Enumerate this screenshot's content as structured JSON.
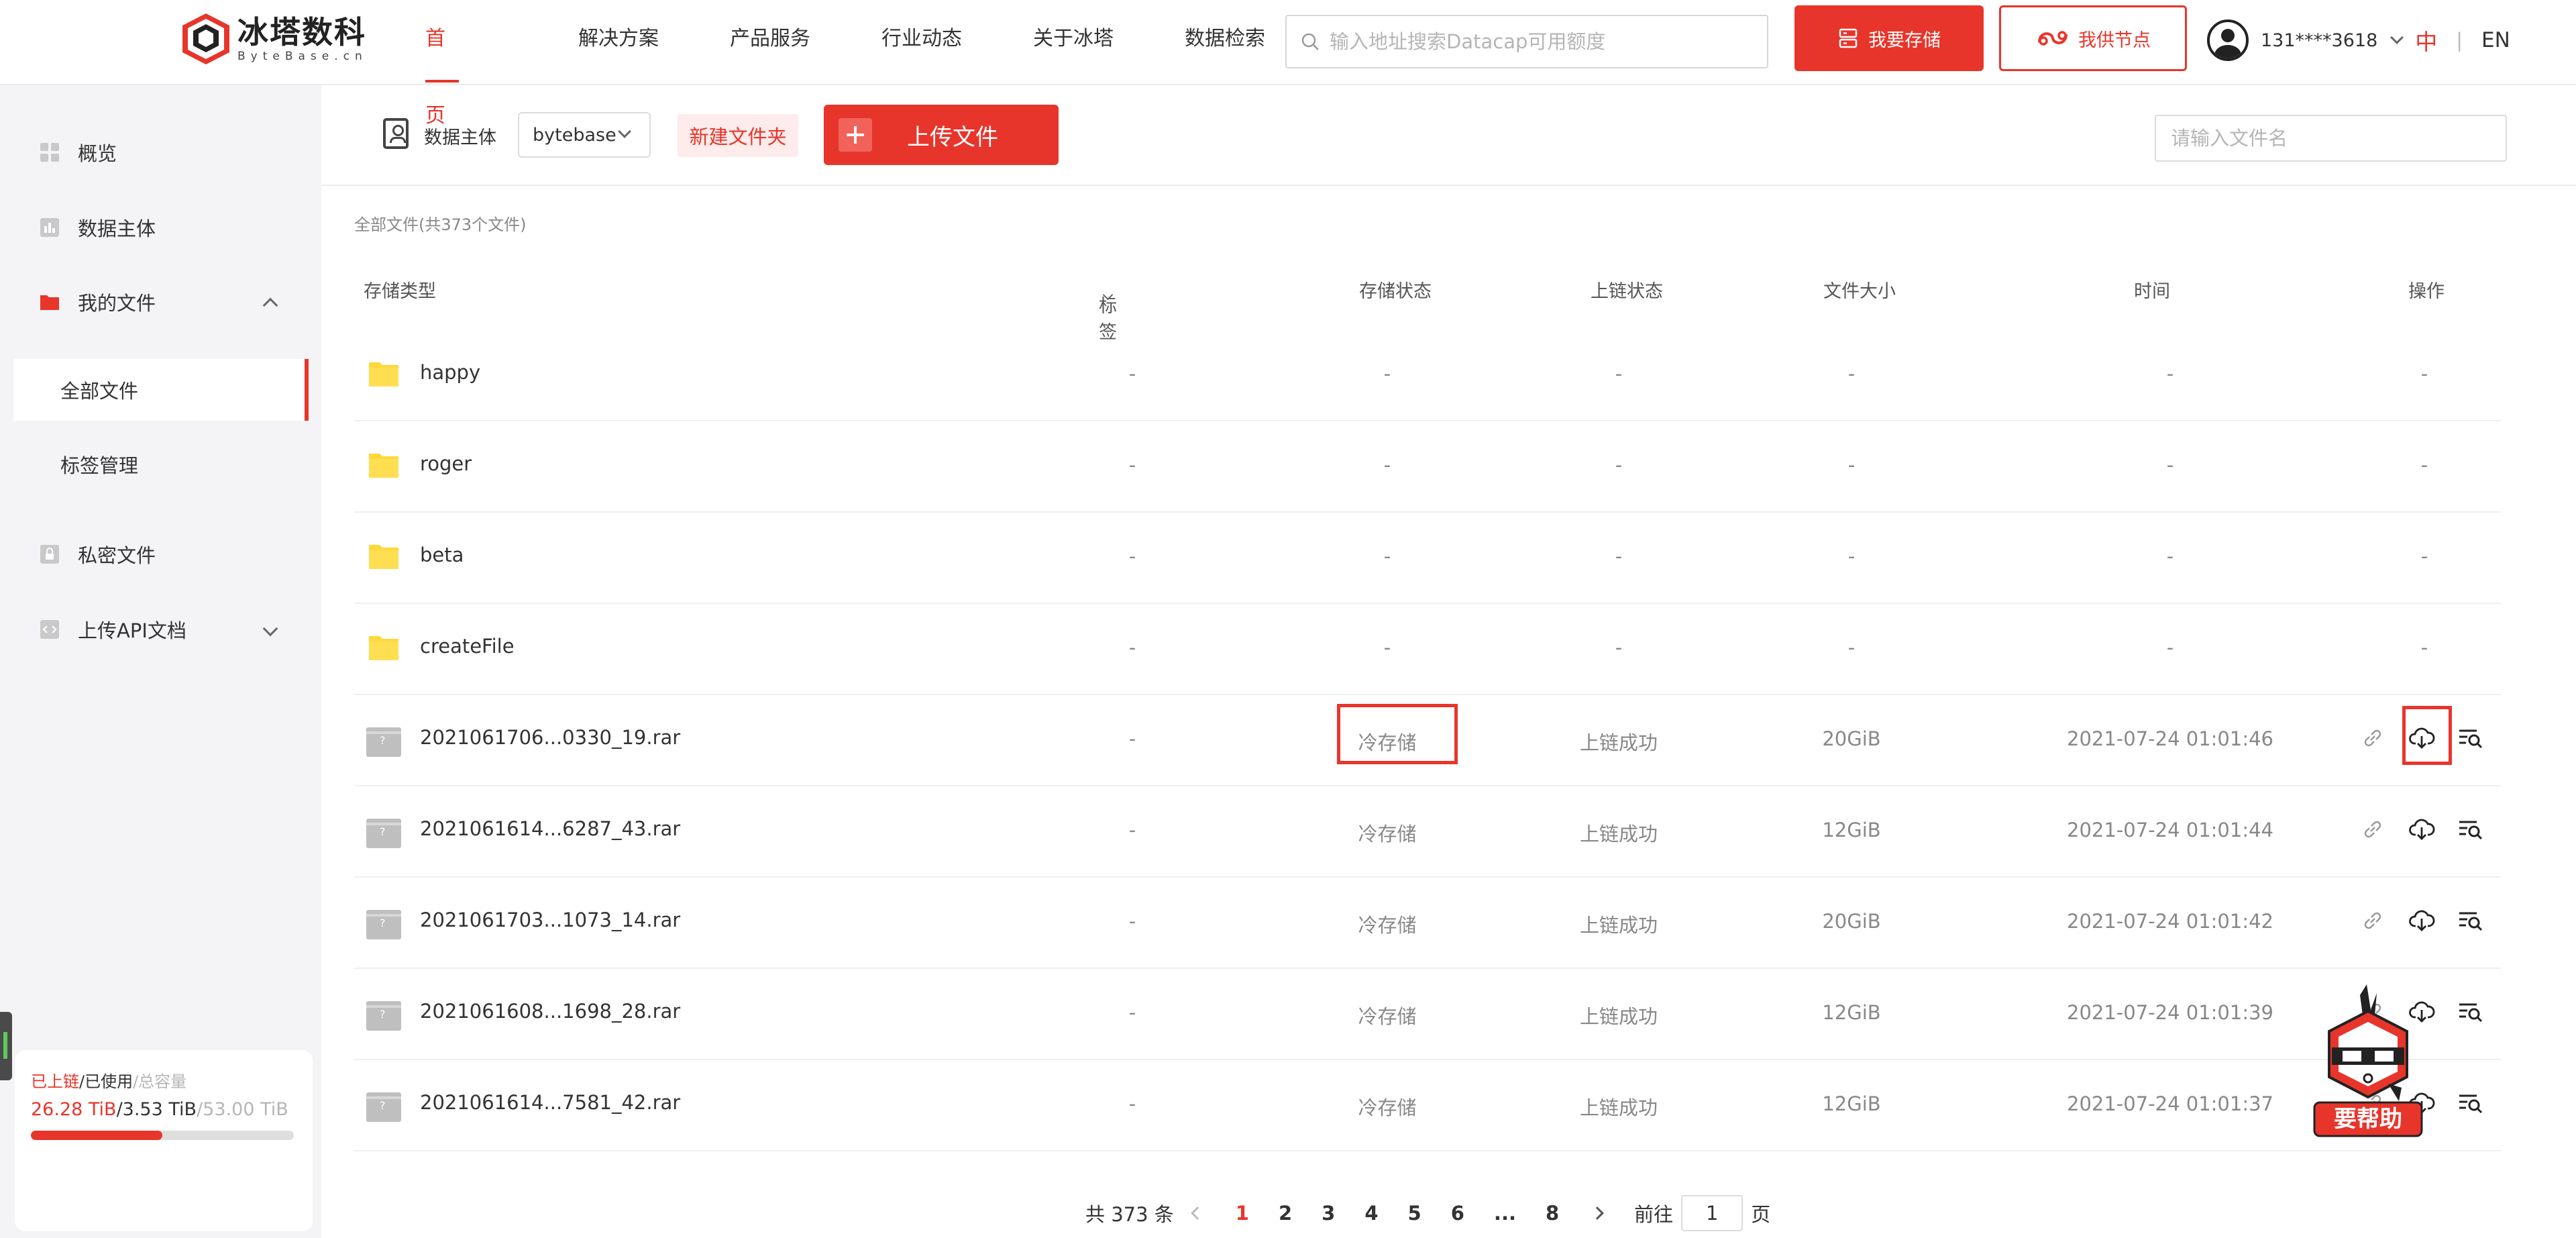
{
  "header": {
    "logo_cn": "冰塔数科",
    "logo_en": "ByteBase.cn",
    "nav": [
      "首页",
      "解决方案",
      "产品服务",
      "行业动态",
      "关于冰塔",
      "数据检索"
    ],
    "search_placeholder": "输入地址搜索Datacap可用额度",
    "btn_store": "我要存储",
    "btn_node": "我供节点",
    "user_phone": "131****3618",
    "lang_zh": "中",
    "lang_sep": "|",
    "lang_en": "EN"
  },
  "sidebar": {
    "overview": "概览",
    "entity": "数据主体",
    "myfiles": "我的文件",
    "allfiles": "全部文件",
    "tags": "标签管理",
    "private": "私密文件",
    "api": "上传API文档"
  },
  "storage": {
    "label_chain": "已上链",
    "label_used": "/已使用",
    "label_total": "/总容量",
    "val_chain": "26.28 TiB",
    "val_used": "/3.53 TiB",
    "val_total": "/53.00 TiB",
    "progress": 0.5
  },
  "toolbar": {
    "entity_label": "数据主体",
    "entity_value": "bytebase",
    "new_folder": "新建文件夹",
    "upload": "上传文件",
    "search_placeholder": "请输入文件名"
  },
  "crumb": "全部文件(共373个文件)",
  "table": {
    "headers": {
      "type": "存储类型",
      "tag": "标签",
      "state": "存储状态",
      "chain": "上链状态",
      "size": "文件大小",
      "time": "时间",
      "op": "操作"
    },
    "rows": [
      {
        "kind": "folder",
        "name": "happy",
        "tag": "-",
        "state": "-",
        "chain": "-",
        "size": "-",
        "time": "-",
        "op": "-"
      },
      {
        "kind": "folder",
        "name": "roger",
        "tag": "-",
        "state": "-",
        "chain": "-",
        "size": "-",
        "time": "-",
        "op": "-"
      },
      {
        "kind": "folder",
        "name": "beta",
        "tag": "-",
        "state": "-",
        "chain": "-",
        "size": "-",
        "time": "-",
        "op": "-"
      },
      {
        "kind": "folder",
        "name": "createFile",
        "tag": "-",
        "state": "-",
        "chain": "-",
        "size": "-",
        "time": "-",
        "op": "-"
      },
      {
        "kind": "file",
        "name": "2021061706...0330_19.rar",
        "tag": "-",
        "state": "冷存储",
        "chain": "上链成功",
        "size": "20GiB",
        "time": "2021-07-24 01:01:46"
      },
      {
        "kind": "file",
        "name": "2021061614...6287_43.rar",
        "tag": "-",
        "state": "冷存储",
        "chain": "上链成功",
        "size": "12GiB",
        "time": "2021-07-24 01:01:44"
      },
      {
        "kind": "file",
        "name": "2021061703...1073_14.rar",
        "tag": "-",
        "state": "冷存储",
        "chain": "上链成功",
        "size": "20GiB",
        "time": "2021-07-24 01:01:42"
      },
      {
        "kind": "file",
        "name": "2021061608...1698_28.rar",
        "tag": "-",
        "state": "冷存储",
        "chain": "上链成功",
        "size": "12GiB",
        "time": "2021-07-24 01:01:39"
      },
      {
        "kind": "file",
        "name": "2021061614...7581_42.rar",
        "tag": "-",
        "state": "冷存储",
        "chain": "上链成功",
        "size": "12GiB",
        "time": "2021-07-24 01:01:37"
      }
    ]
  },
  "pagination": {
    "total": "共 373 条",
    "pages": [
      "1",
      "2",
      "3",
      "4",
      "5",
      "6",
      "...",
      "8"
    ],
    "current": "1",
    "goto_label": "前往",
    "goto_value": "1",
    "goto_unit": "页"
  },
  "mascot_label": "要帮助",
  "colors": {
    "accent": "#e8352b",
    "sidebar_bg": "#f4f4f6",
    "folder": "#ffd83a"
  },
  "icons": {
    "search": "search-icon",
    "store": "server-icon",
    "node": "node-icon",
    "link": "link-icon",
    "download": "cloud-download-icon",
    "detail": "list-search-icon"
  }
}
